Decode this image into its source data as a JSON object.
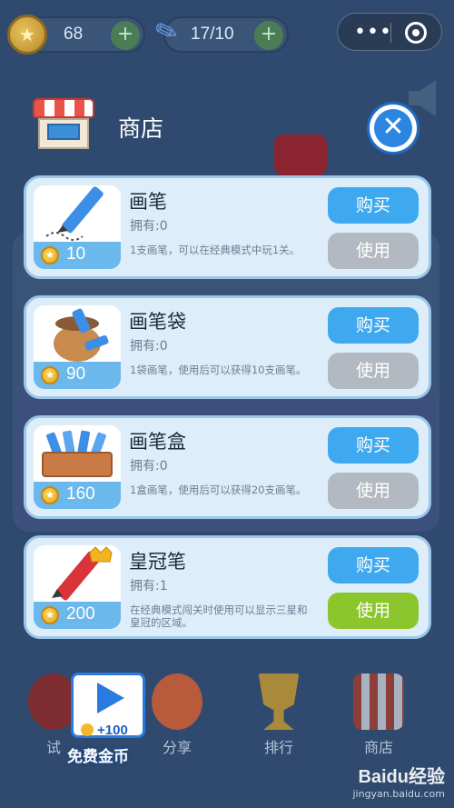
{
  "status_bar": {
    "coins_value": "68",
    "coins_plus": "+",
    "pencils_value": "17/10",
    "pencils_plus": "+",
    "menu_dots": "•••"
  },
  "shop": {
    "title": "商店",
    "close_label": "✕"
  },
  "items": [
    {
      "name": "画笔",
      "owned": "拥有:0",
      "desc": "1支画笔，可以在经典模式中玩1关。",
      "price": "10",
      "buy_label": "购买",
      "use_label": "使用",
      "use_active": false,
      "icon": "pencil-icon"
    },
    {
      "name": "画笔袋",
      "owned": "拥有:0",
      "desc": "1袋画笔，使用后可以获得10支画笔。",
      "price": "90",
      "buy_label": "购买",
      "use_label": "使用",
      "use_active": false,
      "icon": "pencil-bag-icon"
    },
    {
      "name": "画笔盒",
      "owned": "拥有:0",
      "desc": "1盒画笔，使用后可以获得20支画笔。",
      "price": "160",
      "buy_label": "购买",
      "use_label": "使用",
      "use_active": false,
      "icon": "pencil-box-icon"
    },
    {
      "name": "皇冠笔",
      "owned": "拥有:1",
      "desc": "在经典模式闯关时使用可以显示三星和皇冠的区域。",
      "price": "200",
      "buy_label": "购买",
      "use_label": "使用",
      "use_active": true,
      "icon": "crown-pencil-icon"
    }
  ],
  "bottom_nav": {
    "trial": "试",
    "share": "分享",
    "rank": "排行",
    "store": "商店"
  },
  "free_coin": {
    "reward": "+100",
    "caption": "免费金币"
  },
  "watermark": {
    "brand": "Baidu经验",
    "url": "jingyan.baidu.com"
  },
  "colors": {
    "background": "#2f4a6e",
    "buy_button": "#3fa9ef",
    "use_button_inactive": "#b3b9c0",
    "use_button_active": "#8bc62c",
    "close_button": "#2a86e0"
  }
}
